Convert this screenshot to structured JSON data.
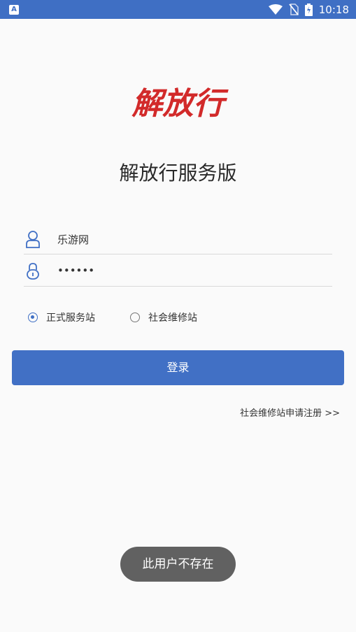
{
  "status_bar": {
    "time": "10:18",
    "icons": [
      "app-notification-icon",
      "wifi-icon",
      "no-sim-icon",
      "battery-charging-icon"
    ]
  },
  "app": {
    "logo_text": "解放行",
    "title": "解放行服务版"
  },
  "form": {
    "username": {
      "icon": "user-icon",
      "value": "乐游网"
    },
    "password": {
      "icon": "lock-icon",
      "value": "••••••"
    },
    "station_type": {
      "options": [
        {
          "label": "正式服务站",
          "selected": true
        },
        {
          "label": "社会维修站",
          "selected": false
        }
      ]
    },
    "login_label": "登录",
    "register_link": "社会维修站申请注册 >>"
  },
  "toast": {
    "message": "此用户不存在"
  },
  "colors": {
    "primary": "#4170c5",
    "logo_red": "#d22a2a",
    "toast_bg": "#616161"
  }
}
